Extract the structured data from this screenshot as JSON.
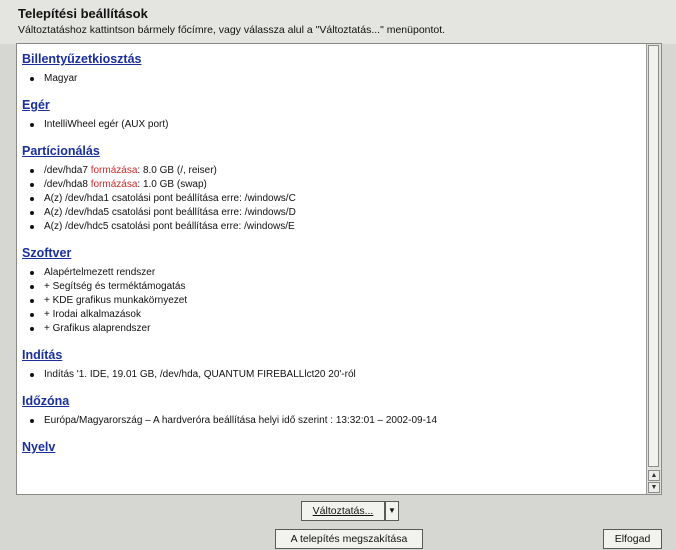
{
  "window": {
    "title": "Telepítési beállítások",
    "subtitle": "Változtatáshoz kattintson bármely főcímre, vagy válassza alul a \"Változtatás...\" menüpontot."
  },
  "sections": {
    "keyboard": {
      "title": "Billentyűzetkiosztás",
      "items": [
        "Magyar"
      ]
    },
    "mouse": {
      "title": "Egér",
      "items": [
        "IntelliWheel egér (AUX port)"
      ]
    },
    "partitioning": {
      "title": "Partícionálás",
      "items": [
        {
          "pre": "/dev/hda7 ",
          "highlight": "formázása",
          "post": ": 8.0 GB (/, reiser)"
        },
        {
          "pre": "/dev/hda8 ",
          "highlight": "formázása",
          "post": ": 1.0 GB (swap)"
        },
        {
          "text": "A(z) /dev/hda1 csatolási pont beállítása erre: /windows/C"
        },
        {
          "text": "A(z) /dev/hda5 csatolási pont beállítása erre: /windows/D"
        },
        {
          "text": "A(z) /dev/hdc5 csatolási pont beállítása erre: /windows/E"
        }
      ]
    },
    "software": {
      "title": "Szoftver",
      "items": [
        "Alapértelmezett rendszer",
        "+ Segítség és terméktámogatás",
        "+ KDE grafikus munkakörnyezet",
        "+ Irodai alkalmazások",
        "+ Grafikus alaprendszer"
      ]
    },
    "boot": {
      "title": "Indítás",
      "items": [
        "Indítás '1. IDE, 19.01 GB, /dev/hda, QUANTUM FIREBALLlct20 20'-ról"
      ]
    },
    "timezone": {
      "title": "Időzóna",
      "items": [
        "Európa/Magyarország – A hardveróra beállítása helyi idő szerint : 13:32:01 – 2002-09-14"
      ]
    },
    "language": {
      "title": "Nyelv"
    }
  },
  "buttons": {
    "change_label": "Változtatás...",
    "change_arrow": "▼",
    "abort_label": "A telepítés megszakítása",
    "accept_label": "Elfogad"
  },
  "scrollbar": {
    "up_arrow": "▲",
    "down_arrow": "▼",
    "position": 0
  },
  "colors": {
    "section_link": "#1a2f9c",
    "highlight": "#cc2a2a",
    "background": "#d6d6d2"
  }
}
